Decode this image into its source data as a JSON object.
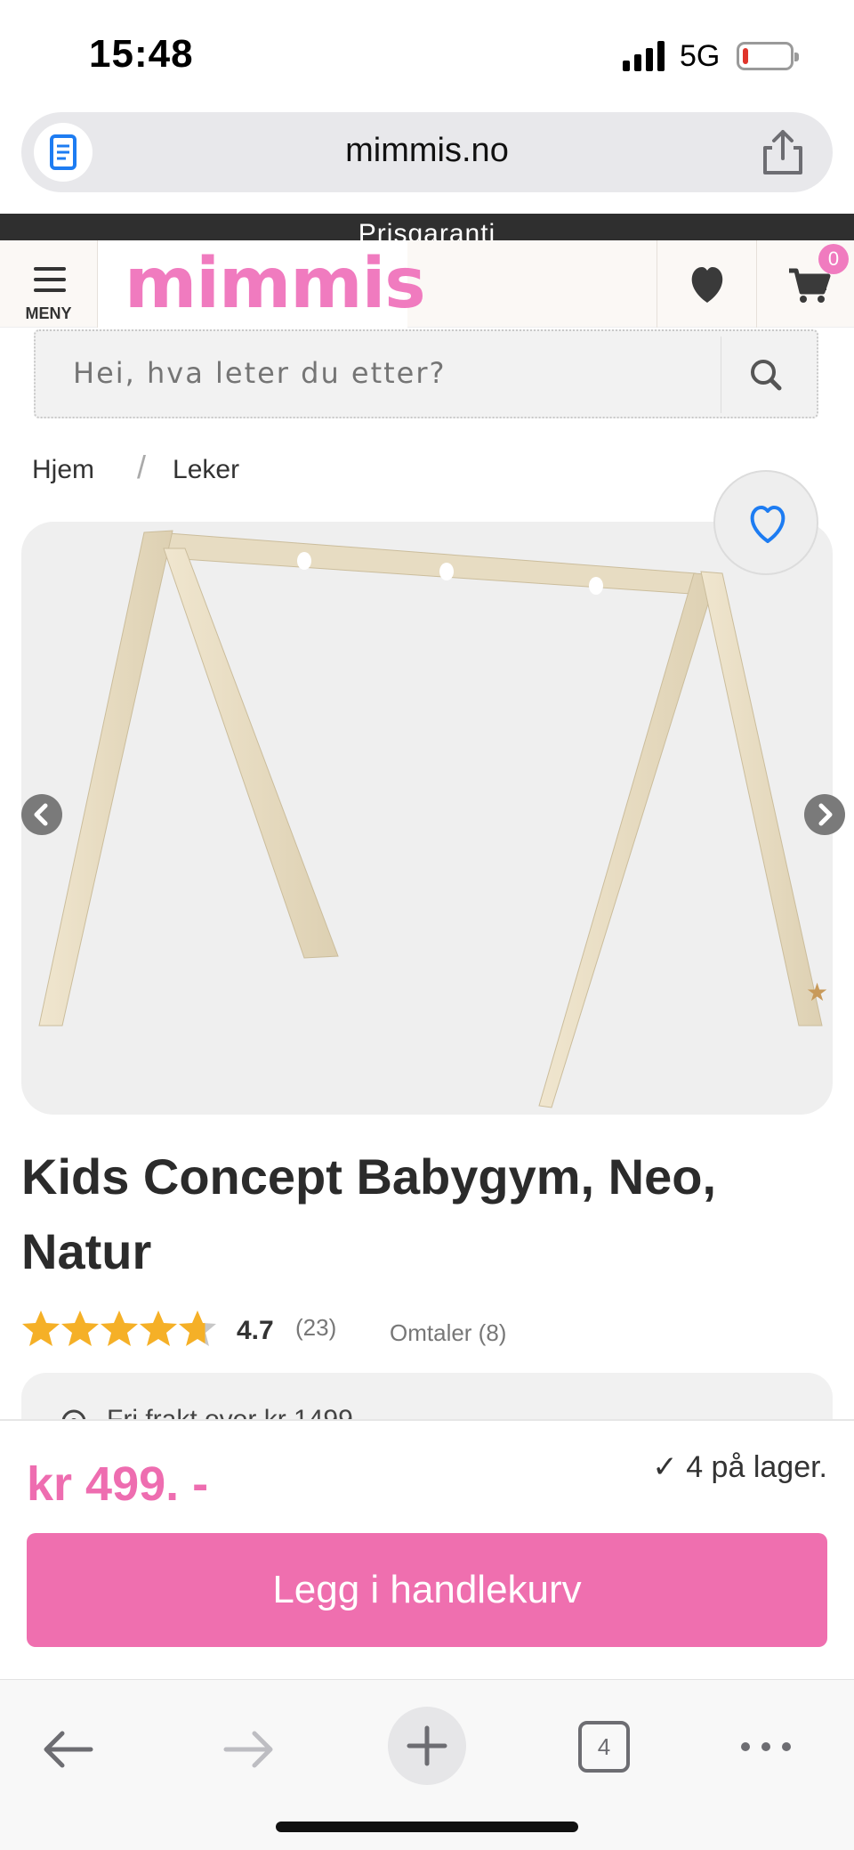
{
  "status_bar": {
    "time": "15:48",
    "network": "5G"
  },
  "browser": {
    "url": "mimmis.no",
    "tab_count": "4"
  },
  "promo": {
    "text": "Prisgaranti"
  },
  "header": {
    "menu_label": "MENY",
    "logo": "mimmis",
    "cart_count": "0"
  },
  "search": {
    "placeholder": "Hei, hva leter du etter?"
  },
  "breadcrumb": {
    "items": [
      "Hjem",
      "Leker"
    ],
    "separator": "/"
  },
  "product": {
    "title": "Kids Concept Babygym, Neo, Natur",
    "rating": "4.7",
    "rating_fraction": 0.94,
    "rating_count": "(23)",
    "reviews_label": "Omtaler (8)",
    "info_text": "Fri frakt over kr 1499"
  },
  "purchase": {
    "price": "kr 499. -",
    "stock": "✓ 4 på lager.",
    "add_to_cart": "Legg i handlekurv"
  },
  "colors": {
    "brand_pink": "#ef6faf",
    "star": "#f5b027",
    "wood": "#e8dcc0"
  }
}
